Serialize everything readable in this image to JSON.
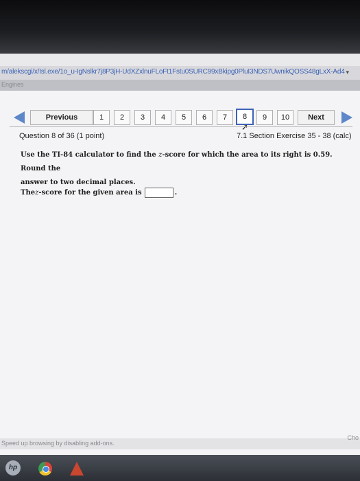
{
  "browser": {
    "url": "m/alekscgi/x/Isl.exe/1o_u-IgNslkr7j8P3jH-UdXZxlnuFLoFt1Fstu0SURC99xBkipg0PluI3NDS7UwnikQOSS48gLxX-Ad4",
    "tab_ghost": "Engines",
    "status_text": "Speed up browsing by disabling add-ons.",
    "status_right": "Cho"
  },
  "nav": {
    "previous_label": "Previous",
    "next_label": "Next",
    "numbers": [
      "1",
      "2",
      "3",
      "4",
      "5",
      "6",
      "7",
      "8",
      "9",
      "10"
    ],
    "current": "8"
  },
  "question": {
    "position": "Question 8 of 36 (1 point)",
    "section": "7.1 Section Exercise 35 - 38 (calc)",
    "line1_a": "Use the TI-84 calculator to find the ",
    "var": "z",
    "line1_b": "-score for which the area to its right is 0.59. Round the",
    "line2": "answer to two decimal places.",
    "answer_a": "The ",
    "answer_var": "z",
    "answer_b": "-score for the given area is",
    "answer_value": "",
    "answer_end": "."
  },
  "taskbar": {
    "hp_label": "hp"
  },
  "colors": {
    "nav_arrow": "#5d87c8",
    "link": "#3d63b5",
    "current_border": "#3d63b5"
  },
  "icons": [
    "left-arrow-icon",
    "right-arrow-icon",
    "cursor-icon",
    "hp-logo-icon",
    "chrome-icon",
    "app-icon"
  ]
}
